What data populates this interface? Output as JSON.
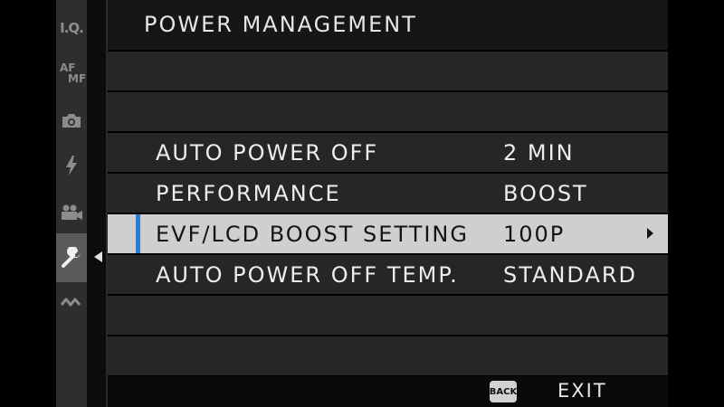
{
  "sidebar": {
    "items": [
      {
        "id": "iq",
        "text": "I.Q."
      },
      {
        "id": "af-mf",
        "text_top": "AF",
        "text_bottom": "MF"
      },
      {
        "id": "shooting",
        "icon": "camera-icon"
      },
      {
        "id": "flash",
        "icon": "flash-icon"
      },
      {
        "id": "movie",
        "icon": "movie-camera-icon"
      },
      {
        "id": "setup",
        "icon": "wrench-icon",
        "active": true
      },
      {
        "id": "connection",
        "icon": "connection-icon"
      }
    ]
  },
  "header": {
    "title": "POWER MANAGEMENT"
  },
  "menu": {
    "rows": [
      {
        "label": "AUTO POWER OFF",
        "value": "2 MIN"
      },
      {
        "label": "PERFORMANCE",
        "value": "BOOST"
      },
      {
        "label": "EVF/LCD BOOST SETTING",
        "value": "100P",
        "selected": true
      },
      {
        "label": "AUTO POWER OFF TEMP.",
        "value": "STANDARD"
      }
    ]
  },
  "footer": {
    "back_label": "BACK",
    "exit_label": "EXIT"
  },
  "colors": {
    "highlight": "#cfcfcf",
    "selection_marker": "#2f7cd6",
    "row_background": "#262626",
    "sidebar_background": "#2e2e2e"
  }
}
